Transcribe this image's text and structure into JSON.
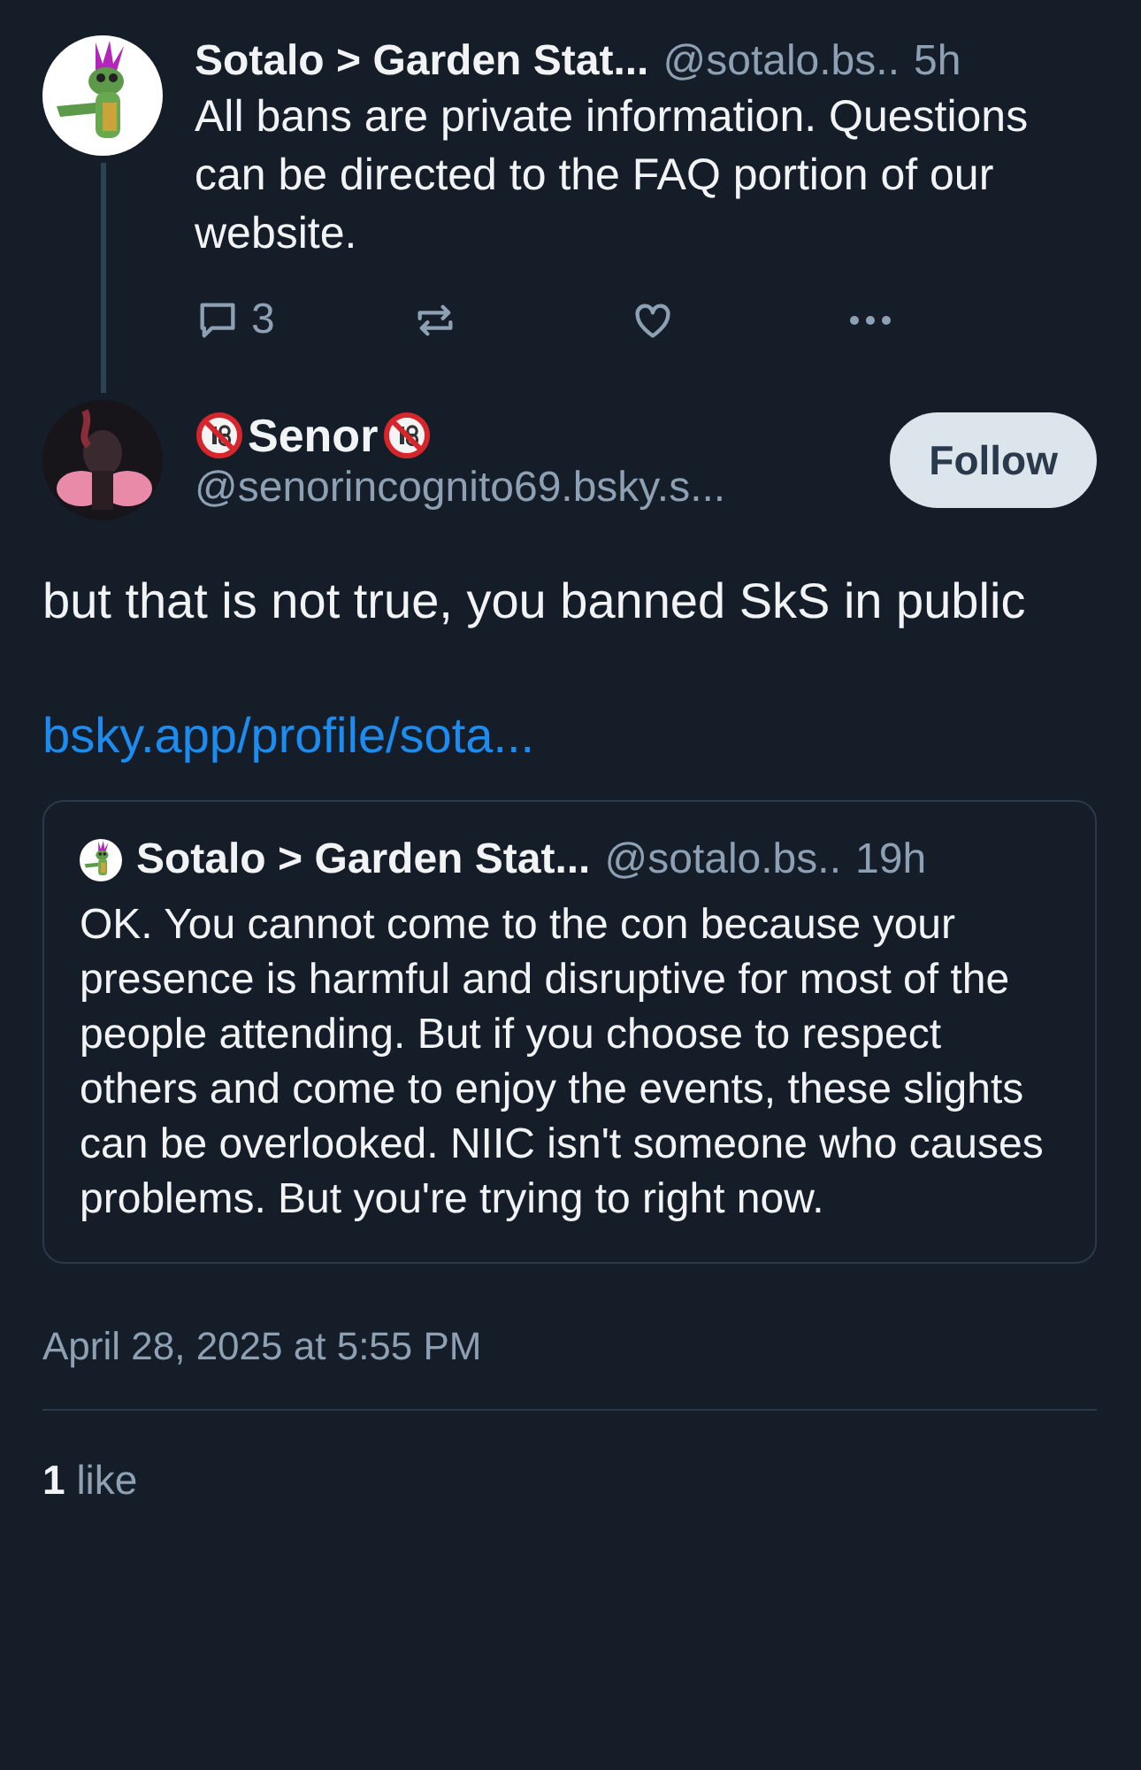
{
  "parent_post": {
    "display_name": "Sotalo > Garden Stat...",
    "handle": "@sotalo.bs..",
    "time": "5h",
    "text": "All bans are private information. Questions can be directed to the FAQ portion of our website.",
    "reply_count": "3"
  },
  "main_post": {
    "display_name": "Senor",
    "handle": "@senorincognito69.bsky.s...",
    "follow_label": "Follow",
    "text": "but that is not true, you banned SkS in public",
    "link": "bsky.app/profile/sota...",
    "quote": {
      "display_name": "Sotalo > Garden Stat...",
      "handle": "@sotalo.bs..",
      "time": "19h",
      "text": "OK. You cannot come to the con because your presence is harmful and disruptive for most of the people attending. But if you choose to respect others and come to enjoy the events, these slights can be overlooked. NIIC isn't someone who causes problems. But you're trying to right now."
    },
    "timestamp": "April 28, 2025 at 5:55 PM",
    "like_count": "1",
    "like_label": "like"
  }
}
